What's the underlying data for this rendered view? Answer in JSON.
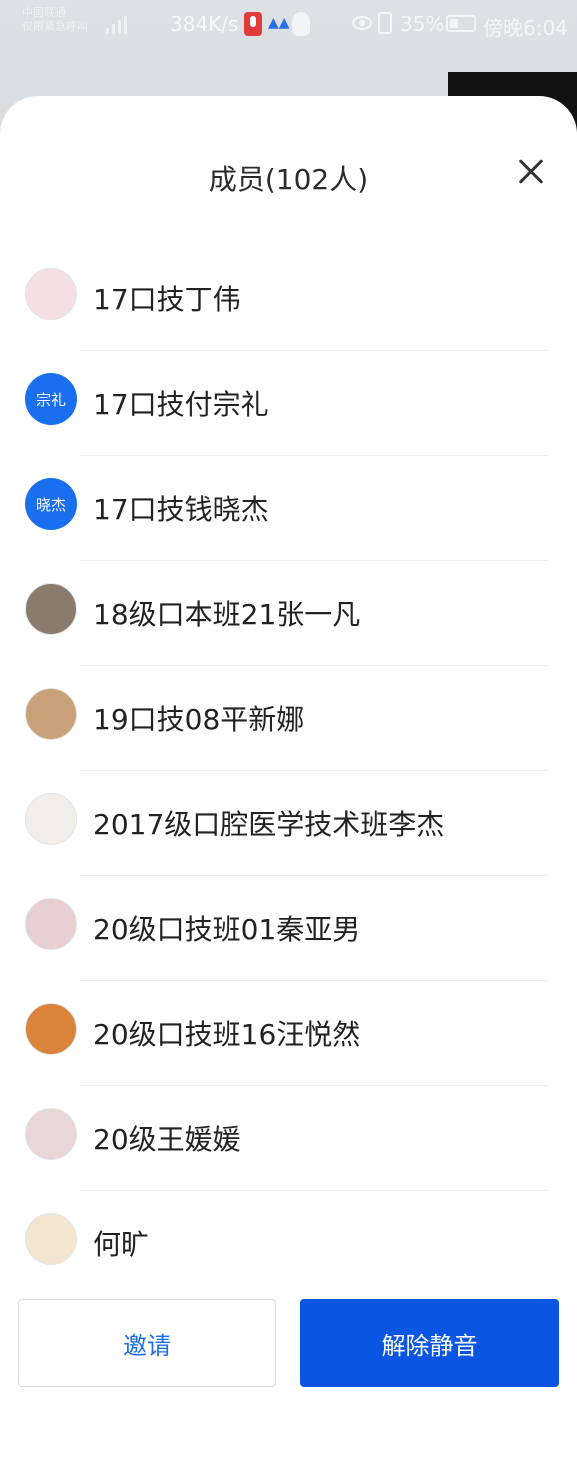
{
  "status_bar": {
    "carrier_line1": "中国联通",
    "carrier_line2": "仅限紧急呼叫",
    "network_speed": "384K/s",
    "battery_percent": "35%",
    "time": "傍晚6:04"
  },
  "sheet": {
    "title": "成员(102人)"
  },
  "members": [
    {
      "name": "17口技丁伟",
      "avatar_text": "",
      "avatar_color": "#f6dfe3"
    },
    {
      "name": "17口技付宗礼",
      "avatar_text": "宗礼",
      "avatar_color": "#1a6ef0"
    },
    {
      "name": "17口技钱晓杰",
      "avatar_text": "晓杰",
      "avatar_color": "#1a6ef0"
    },
    {
      "name": "18级口本班21张一凡",
      "avatar_text": "",
      "avatar_color": "#8a7b6c"
    },
    {
      "name": "19口技08平新娜",
      "avatar_text": "",
      "avatar_color": "#c9a27a"
    },
    {
      "name": "2017级口腔医学技术班李杰",
      "avatar_text": "",
      "avatar_color": "#f2efe8"
    },
    {
      "name": "20级口技班01秦亚男",
      "avatar_text": "",
      "avatar_color": "#e8cfd0"
    },
    {
      "name": "20级口技班16汪悦然",
      "avatar_text": "",
      "avatar_color": "#d9843a"
    },
    {
      "name": "20级王媛媛",
      "avatar_text": "",
      "avatar_color": "#e9d6d6"
    },
    {
      "name": "何旷",
      "avatar_text": "",
      "avatar_color": "#f3e5cf"
    }
  ],
  "buttons": {
    "invite": "邀请",
    "unmute": "解除静音"
  },
  "colors": {
    "accent": "#0a55e2",
    "link": "#1a6ef0"
  }
}
